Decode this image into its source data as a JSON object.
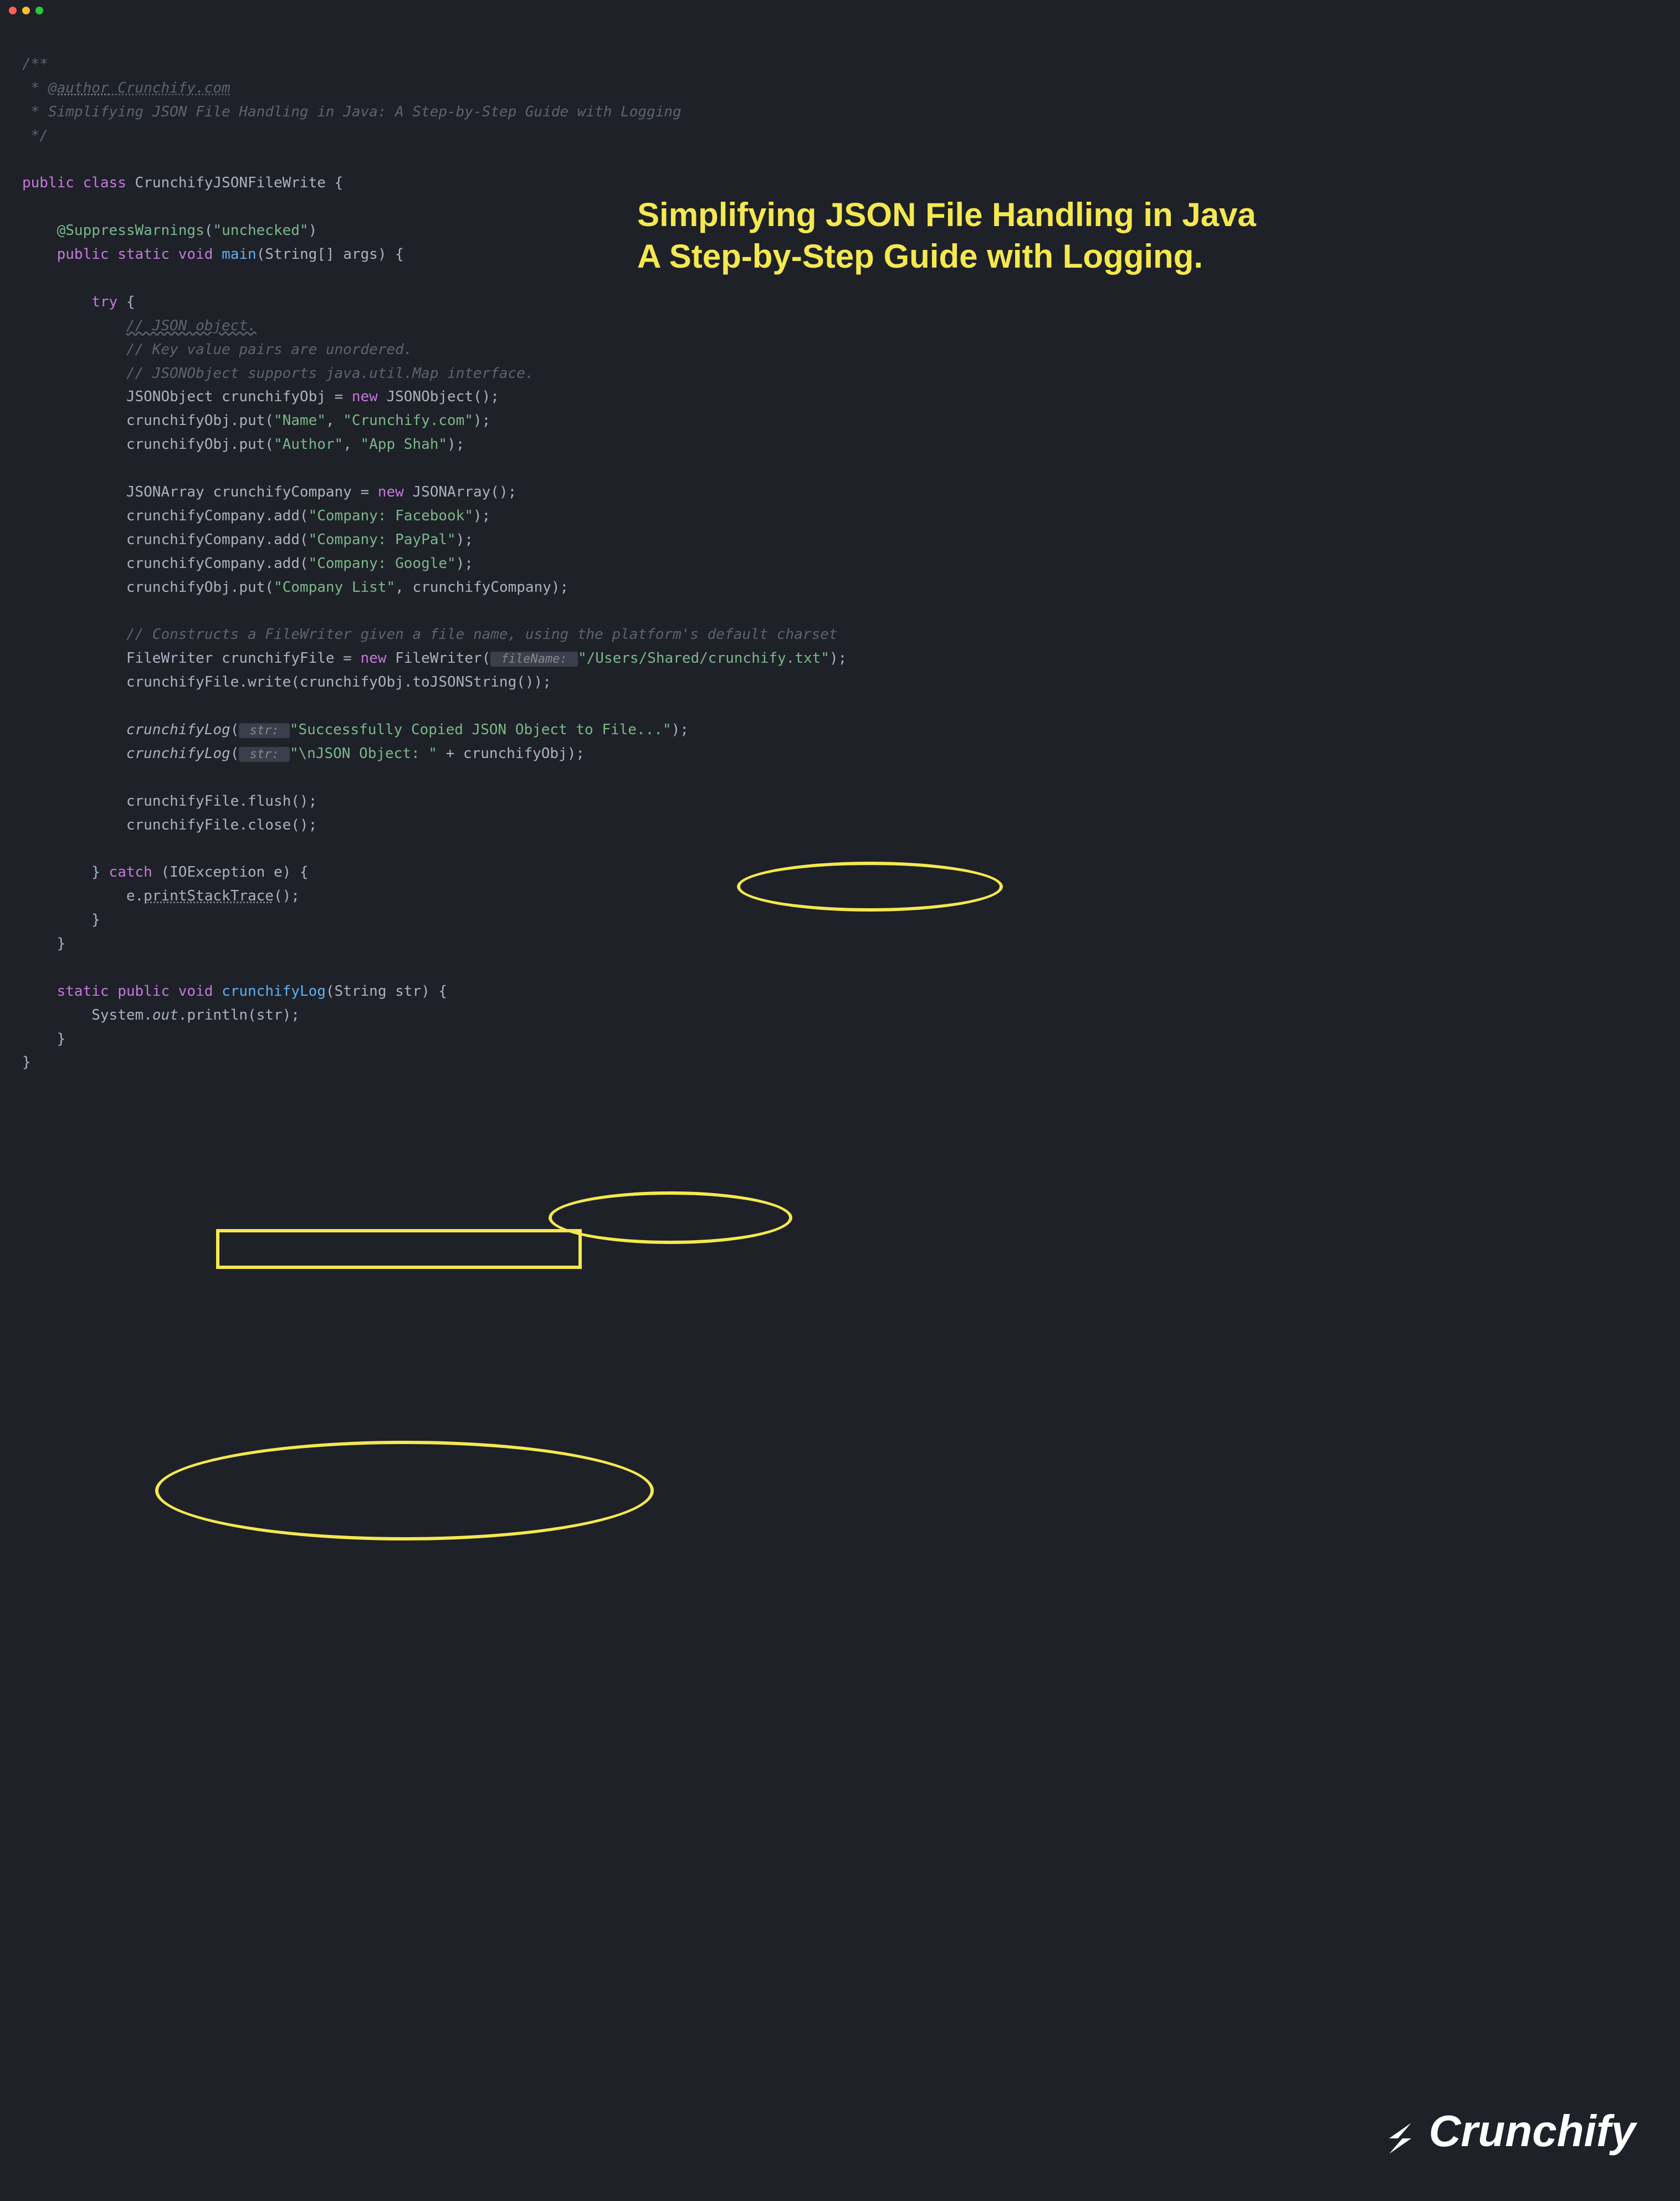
{
  "window": {
    "dots": [
      "red",
      "yellow",
      "green"
    ]
  },
  "overlay": {
    "line1": "Simplifying JSON File Handling in Java",
    "line2": "A Step-by-Step Guide with Logging."
  },
  "logo_text": "Crunchify",
  "colors": {
    "bg": "#1e2128",
    "highlight": "#f5e84f",
    "keyword": "#c678dd",
    "string": "#7bb78a",
    "comment": "#5c6370",
    "method": "#56b6c2",
    "default": "#abb2bf",
    "funcdef": "#61afef"
  },
  "code": {
    "doc1": "/**",
    "doc2a": " * ",
    "doc2b": "@author",
    "doc2c": " Crunchify.com",
    "doc3": " * Simplifying JSON File Handling in Java: A Step-by-Step Guide with Logging",
    "doc4": " */",
    "kw_public": "public",
    "kw_class": "class",
    "class_name": "CrunchifyJSONFileWrite",
    "brace_open": " {",
    "annotation": "@SuppressWarnings",
    "annotation_arg": "\"unchecked\"",
    "kw_static": "static",
    "kw_void": "void",
    "main_name": "main",
    "main_params": "(String[] args) {",
    "kw_try": "try",
    "try_brace": " {",
    "cmt_json": "// JSON object.",
    "cmt_kv": "// Key value pairs are unordered.",
    "cmt_map": "// JSONObject supports java.util.Map interface.",
    "line_obj_decl_a": "JSONObject crunchifyObj = ",
    "kw_new": "new",
    "line_obj_decl_b": " JSONObject();",
    "put_name_a": "crunchifyObj.put(",
    "str_name": "\"Name\"",
    "comma_sp": ", ",
    "str_crunchify": "\"Crunchify.com\"",
    "paren_semi": ");",
    "str_author": "\"Author\"",
    "str_appshah": "\"App Shah\"",
    "line_arr_decl_a": "JSONArray crunchifyCompany = ",
    "line_arr_decl_b": " JSONArray();",
    "add_call_a": "crunchifyCompany.add(",
    "str_fb": "\"Company: Facebook\"",
    "str_pp": "\"Company: PayPal\"",
    "str_gg": "\"Company: Google\"",
    "str_clist": "\"Company List\"",
    "put_clist_tail": ", crunchifyCompany);",
    "cmt_fw": "// Constructs a FileWriter given a file name, using the platform's default charset",
    "fw_decl_a": "FileWriter crunchifyFile = ",
    "fw_decl_b": " FileWriter(",
    "hint_fileName": " fileName: ",
    "str_path": "\"/Users/Shared/crunchify.txt\"",
    "fw_write": "crunchifyFile.write(crunchifyObj.toJSONString());",
    "log_call": "crunchifyLog",
    "log_open": "(",
    "hint_str": " str: ",
    "str_success": "\"Successfully Copied JSON Object to File...\"",
    "str_json_obj": "\"\\nJSON Object: \"",
    "log_concat": " + crunchifyObj);",
    "flush": "crunchifyFile.flush();",
    "close": "crunchifyFile.close();",
    "brace_close": "}",
    "kw_catch": "catch",
    "catch_params": " (IOException e) {",
    "pst_a": "e.",
    "pst_b": "printStackTrace",
    "pst_c": "();",
    "log_def_name": "crunchifyLog",
    "log_def_params": "(String str) {",
    "sout_a": "System.",
    "sout_b": "out",
    "sout_c": ".println(str);",
    "paren_close": ")"
  }
}
